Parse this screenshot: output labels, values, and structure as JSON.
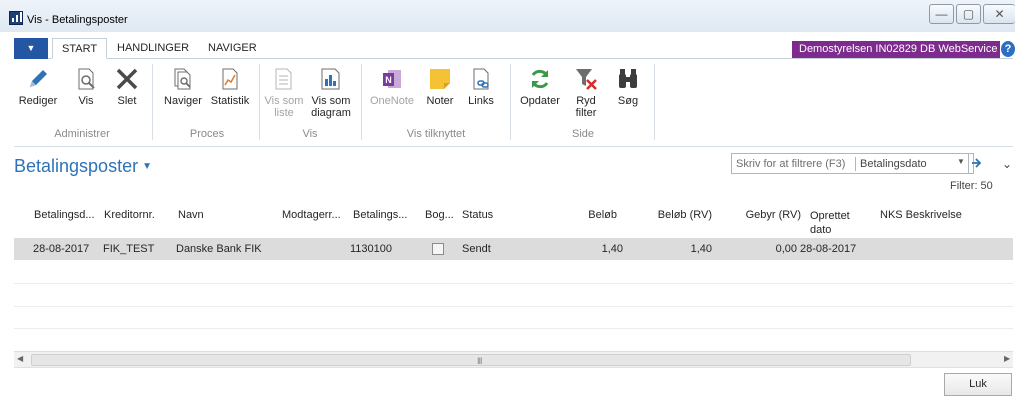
{
  "window": {
    "title": "Vis - Betalingsposter"
  },
  "ribbon_tabs": [
    {
      "label": "START"
    },
    {
      "label": "HANDLINGER"
    },
    {
      "label": "NAVIGER"
    }
  ],
  "company_badge": "Demostyrelsen IN02829 DB WebService",
  "help_label": "?",
  "ribbon": {
    "buttons": {
      "rediger": "Rediger",
      "vis": "Vis",
      "slet": "Slet",
      "naviger": "Naviger",
      "statistik": "Statistik",
      "vis_som_liste": "Vis som liste",
      "vis_som_diagram": "Vis som diagram",
      "onenote": "OneNote",
      "noter": "Noter",
      "links": "Links",
      "opdater": "Opdater",
      "ryd_filter": "Ryd filter",
      "sog": "Søg"
    },
    "groups": {
      "administrer": "Administrer",
      "proces": "Proces",
      "vis": "Vis",
      "vis_tilknyttet": "Vis tilknyttet",
      "side": "Side"
    }
  },
  "page": {
    "title": "Betalingsposter",
    "filter_placeholder": "Skriv for at filtrere (F3)",
    "filter_field": "Betalingsdato",
    "filter_count": "Filter: 50"
  },
  "columns": {
    "betalingsdato": "Betalingsd...",
    "kreditornr": "Kreditornr.",
    "navn": "Navn",
    "modtager": "Modtagerr...",
    "betalings": "Betalings...",
    "bog": "Bog...",
    "status": "Status",
    "belob": "Beløb",
    "belob_rv": "Beløb (RV)",
    "gebyr_rv": "Gebyr (RV)",
    "oprettet_dato": "Oprettet dato",
    "nks": "NKS Beskrivelse"
  },
  "rows": [
    {
      "betalingsdato": "28-08-2017",
      "kreditornr": "FIK_TEST",
      "navn": "Danske Bank FIK",
      "modtager": "",
      "betalings": "1130100",
      "bog": false,
      "status": "Sendt",
      "belob": "1,40",
      "belob_rv": "1,40",
      "gebyr_rv": "0,00",
      "oprettet_dato": "28-08-2017",
      "nks": ""
    }
  ],
  "scroll_grip": "III",
  "close_button": "Luk",
  "icons": {
    "edit": "pencil-icon",
    "view": "document-magnifier-icon",
    "delete": "x-icon",
    "navigate": "document-stack-icon",
    "statistics": "chart-document-icon",
    "list": "list-view-icon",
    "chart": "bar-chart-icon",
    "onenote": "onenote-icon",
    "notes": "note-icon",
    "links": "link-document-icon",
    "refresh": "refresh-icon",
    "clear_filter": "clear-filter-icon",
    "search": "binoculars-icon"
  },
  "colors": {
    "accent_blue": "#2356a3",
    "title_blue": "#2e73b8",
    "company_purple": "#7d2c8e",
    "refresh_green": "#3a9a4a",
    "onenote_purple": "#7a3aa0",
    "note_yellow": "#f5c236",
    "clear_filter_red": "#d62b2b"
  }
}
